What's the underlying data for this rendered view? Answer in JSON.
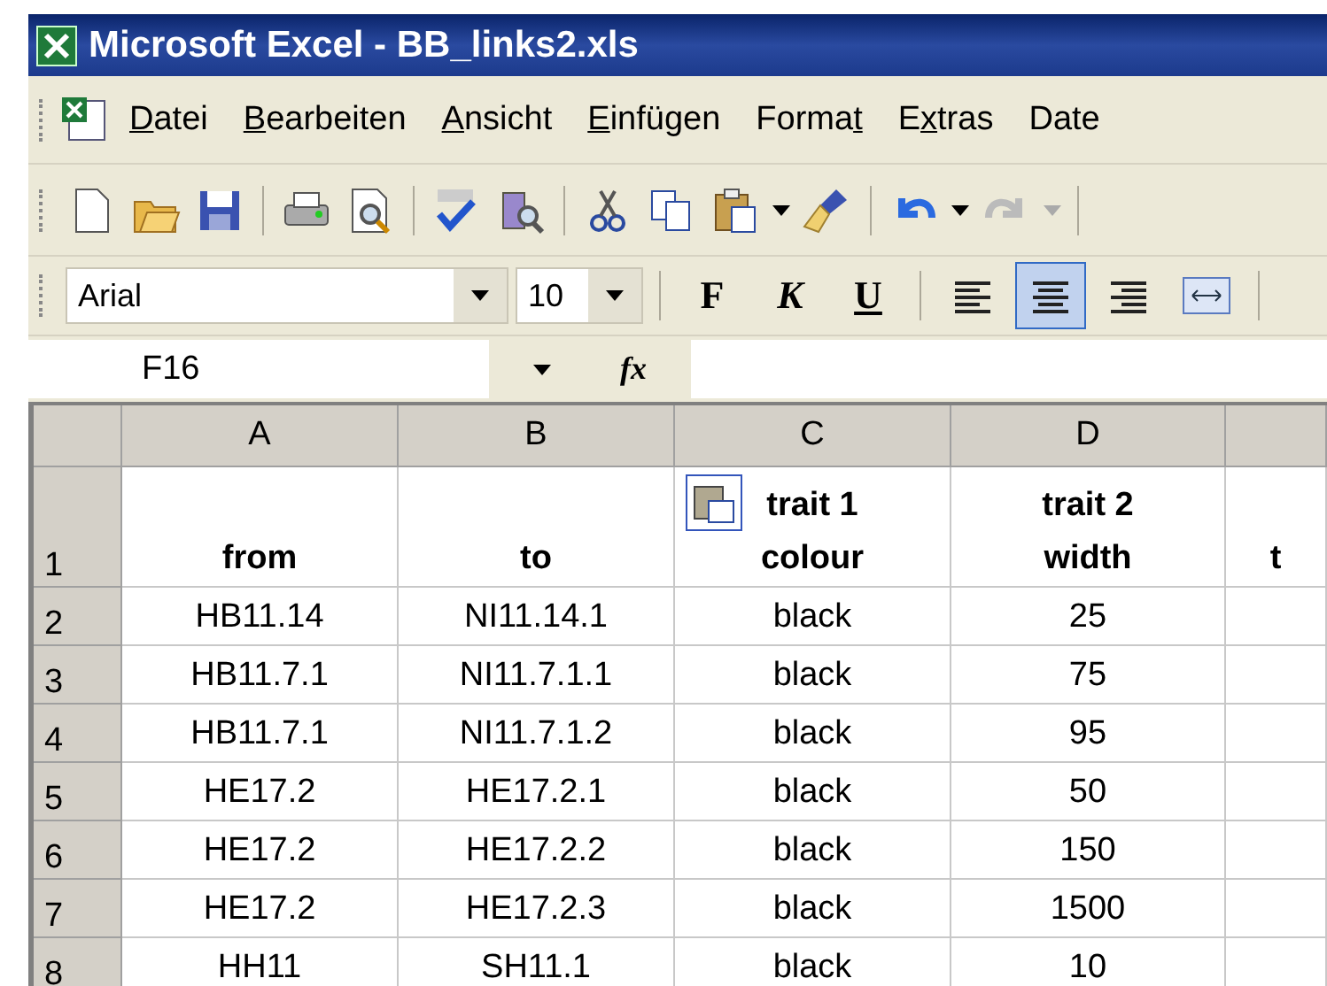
{
  "window": {
    "title": "Microsoft Excel - BB_links2.xls"
  },
  "menu": [
    {
      "access": "D",
      "rest": "atei"
    },
    {
      "access": "B",
      "rest": "earbeiten"
    },
    {
      "access": "A",
      "rest": "nsicht"
    },
    {
      "access": "E",
      "rest": "infügen"
    },
    {
      "lead": "Forma",
      "access": "t"
    },
    {
      "lead": "E",
      "access": "x",
      "rest": "tras"
    },
    {
      "lead": "Date"
    }
  ],
  "standard_toolbar": [
    {
      "kind": "new"
    },
    {
      "kind": "open"
    },
    {
      "kind": "save"
    },
    {
      "kind": "sep"
    },
    {
      "kind": "print"
    },
    {
      "kind": "preview"
    },
    {
      "kind": "sep"
    },
    {
      "kind": "spell"
    },
    {
      "kind": "research"
    },
    {
      "kind": "sep"
    },
    {
      "kind": "cut"
    },
    {
      "kind": "copy"
    },
    {
      "kind": "paste"
    },
    {
      "kind": "caret",
      "disabled": false
    },
    {
      "kind": "brush"
    },
    {
      "kind": "sep"
    },
    {
      "kind": "undo"
    },
    {
      "kind": "caret",
      "disabled": false
    },
    {
      "kind": "redo"
    },
    {
      "kind": "caret",
      "disabled": true
    },
    {
      "kind": "sep"
    }
  ],
  "format_toolbar": {
    "font": "Arial",
    "size": "10",
    "styles": [
      {
        "label": "F",
        "kind": "bold"
      },
      {
        "label": "K",
        "kind": "italic"
      },
      {
        "label": "U",
        "kind": "underline"
      }
    ],
    "align": [
      {
        "kind": "left",
        "selected": false
      },
      {
        "kind": "center",
        "selected": true
      },
      {
        "kind": "right",
        "selected": false
      },
      {
        "kind": "merge",
        "selected": false
      }
    ]
  },
  "formula_bar": {
    "name_box": "F16",
    "fx": "fx"
  },
  "sheet": {
    "columns": [
      "A",
      "B",
      "C",
      "D",
      ""
    ],
    "rows": [
      {
        "number": "1",
        "cells": [
          "from",
          "to",
          "trait 1\ncolour",
          "trait 2\nwidth",
          "t"
        ],
        "header": true
      },
      {
        "number": "2",
        "cells": [
          "HB11.14",
          "NI11.14.1",
          "black",
          "25",
          ""
        ]
      },
      {
        "number": "3",
        "cells": [
          "HB11.7.1",
          "NI11.7.1.1",
          "black",
          "75",
          ""
        ]
      },
      {
        "number": "4",
        "cells": [
          "HB11.7.1",
          "NI11.7.1.2",
          "black",
          "95",
          ""
        ]
      },
      {
        "number": "5",
        "cells": [
          "HE17.2",
          "HE17.2.1",
          "black",
          "50",
          ""
        ]
      },
      {
        "number": "6",
        "cells": [
          "HE17.2",
          "HE17.2.2",
          "black",
          "150",
          ""
        ]
      },
      {
        "number": "7",
        "cells": [
          "HE17.2",
          "HE17.2.3",
          "black",
          "1500",
          ""
        ]
      },
      {
        "number": "8",
        "cells": [
          "HH11",
          "SH11.1",
          "black",
          "10",
          ""
        ]
      }
    ]
  }
}
